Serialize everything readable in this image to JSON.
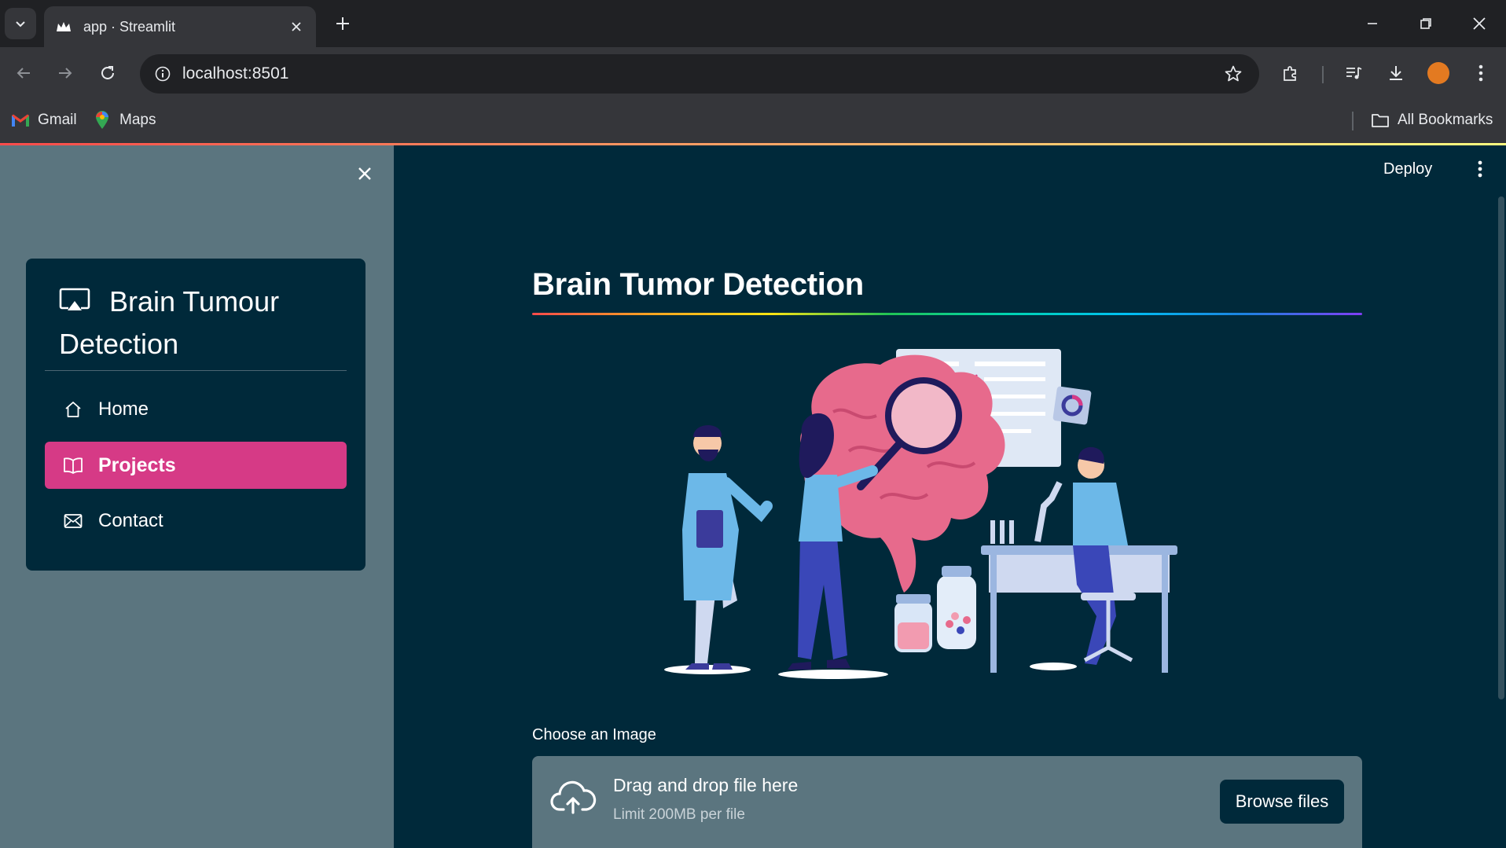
{
  "browser": {
    "tab_title": "app · Streamlit",
    "url": "localhost:8501",
    "bookmarks": [
      {
        "label": "Gmail",
        "icon": "gmail-icon"
      },
      {
        "label": "Maps",
        "icon": "maps-icon"
      }
    ],
    "all_bookmarks_label": "All Bookmarks",
    "profile_color": "#e37a21"
  },
  "header": {
    "deploy_label": "Deploy"
  },
  "sidebar": {
    "menu_title": "Brain Tumour Detection",
    "menu_icon": "cast-icon",
    "items": [
      {
        "label": "Home",
        "icon": "house-icon",
        "active": false
      },
      {
        "label": "Projects",
        "icon": "book-icon",
        "active": true
      },
      {
        "label": "Contact",
        "icon": "envelope-icon",
        "active": false
      }
    ],
    "active_color": "#d63a86"
  },
  "main": {
    "title": "Brain Tumor Detection",
    "uploader": {
      "label": "Choose an Image",
      "drop_text": "Drag and drop file here",
      "limit_text": "Limit 200MB per file",
      "browse_label": "Browse files"
    }
  },
  "colors": {
    "app_background": "#00293a",
    "sidebar_background": "#5b757f"
  }
}
